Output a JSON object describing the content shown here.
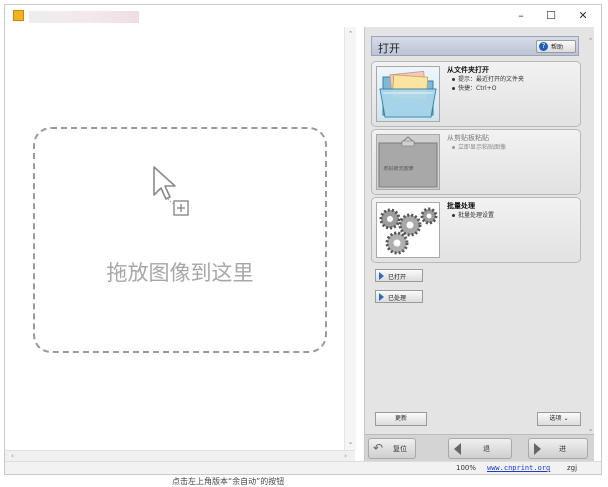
{
  "window": {
    "title": "",
    "minimize": "–",
    "maximize": "☐",
    "close": "✕",
    "app_icon": "app-icon"
  },
  "drop_zone": {
    "text": "拖放图像到这里",
    "icon": "drag-drop-cursor-icon"
  },
  "task_pane": {
    "title": "打开",
    "help_label": "帮助",
    "cards": [
      {
        "title": "从文件夹打开",
        "lines": [
          "提示：最近打开的文件夹",
          "快捷：Ctrl+O"
        ],
        "enabled": true,
        "icon": "folder-icon"
      },
      {
        "title": "从剪贴板粘贴",
        "lines": [
          "立即显示粘贴图像"
        ],
        "enabled": false,
        "icon": "clipboard-icon",
        "icon_caption": "剪贴板无图像"
      },
      {
        "title": "批量处理",
        "lines": [
          "批量处理设置"
        ],
        "enabled": true,
        "icon": "gears-icon"
      }
    ],
    "expanders": [
      "已打开",
      "已处理"
    ],
    "update_label": "更新",
    "options_label": "选项"
  },
  "nav": {
    "reset_label": "复位",
    "back_label": "退",
    "forward_label": "进"
  },
  "status": {
    "zoom": "100%",
    "url": "www.cnprint.org",
    "user": "zgj"
  },
  "footer_text": "点击左上角版本“余自动”的按钮"
}
